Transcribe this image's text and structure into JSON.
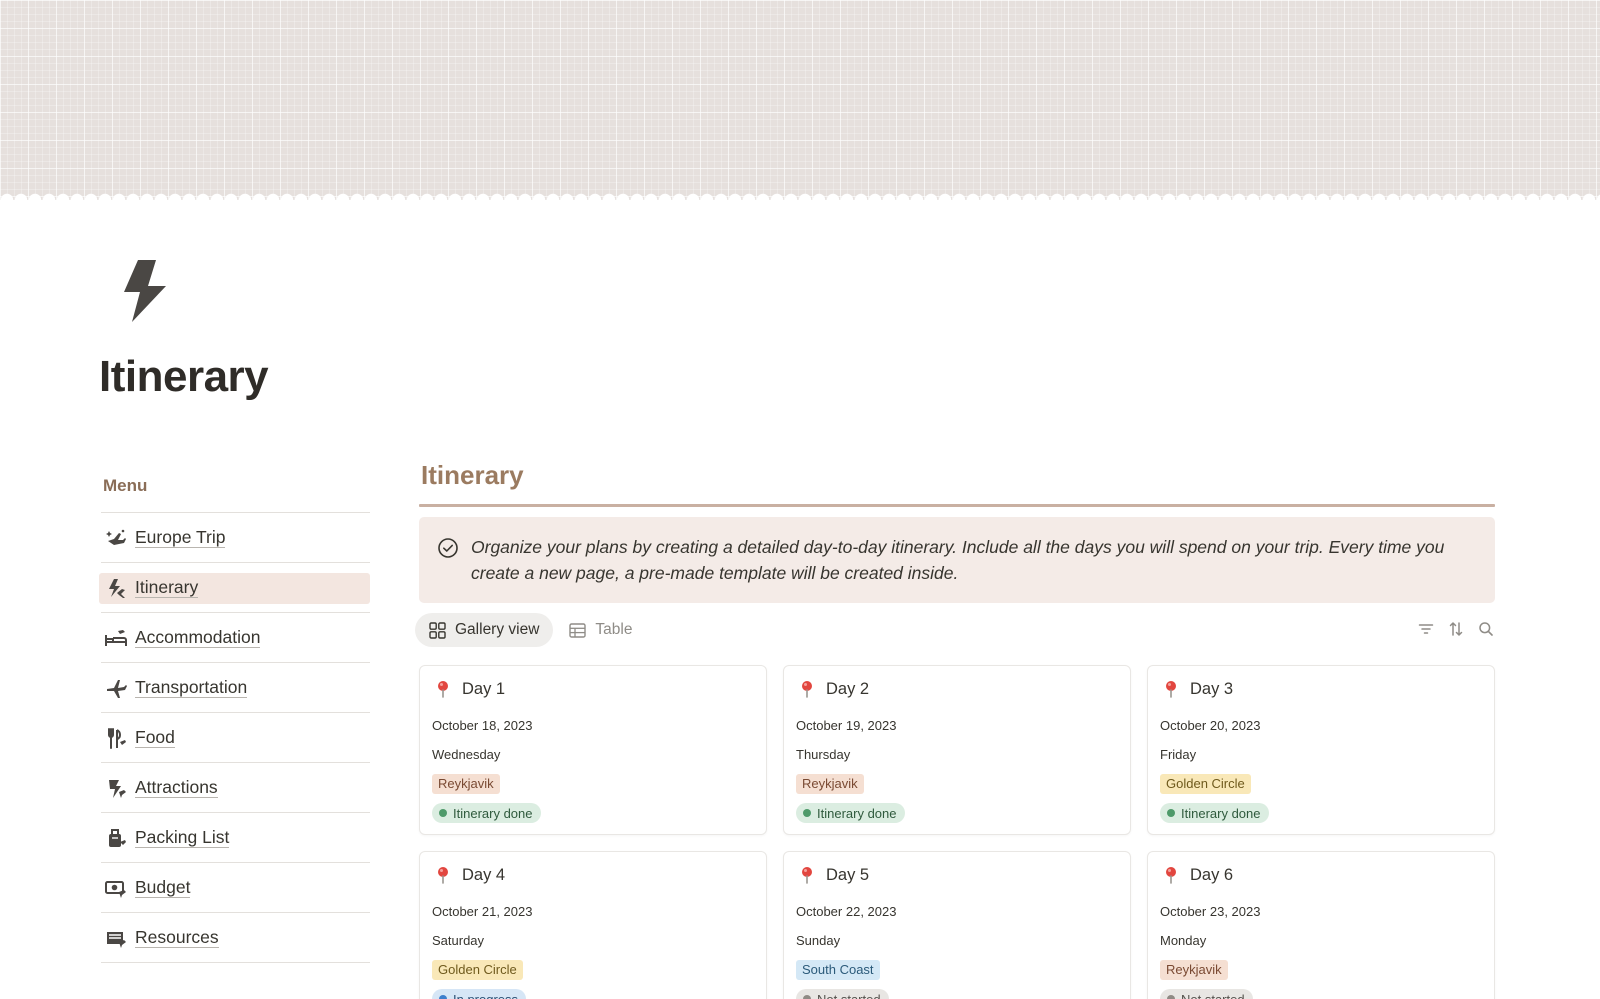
{
  "page": {
    "title": "Itinerary",
    "icon": "lightning-bolt-icon"
  },
  "menu": {
    "heading": "Menu",
    "items": [
      {
        "label": "Europe Trip",
        "icon": "airplane-sparkle-icon",
        "active": false
      },
      {
        "label": "Itinerary",
        "icon": "lightning-plane-icon",
        "active": true
      },
      {
        "label": "Accommodation",
        "icon": "bed-plane-icon",
        "active": false
      },
      {
        "label": "Transportation",
        "icon": "plane-icon",
        "active": false
      },
      {
        "label": "Food",
        "icon": "fork-knife-icon",
        "active": false
      },
      {
        "label": "Attractions",
        "icon": "attraction-icon",
        "active": false
      },
      {
        "label": "Packing List",
        "icon": "luggage-icon",
        "active": false
      },
      {
        "label": "Budget",
        "icon": "money-icon",
        "active": false
      },
      {
        "label": "Resources",
        "icon": "inbox-icon",
        "active": false
      }
    ]
  },
  "main": {
    "section_title": "Itinerary",
    "callout": {
      "icon": "check-circle-icon",
      "text": "Organize your plans by creating a detailed day-to-day itinerary. Include all the days you will spend on your trip. Every time you create a new page, a pre-made template will be created inside."
    },
    "views": [
      {
        "label": "Gallery view",
        "icon": "gallery-icon",
        "active": true
      },
      {
        "label": "Table",
        "icon": "table-icon",
        "active": false
      }
    ],
    "tools": [
      "filter-icon",
      "sort-icon",
      "search-icon"
    ],
    "cards": [
      {
        "title": "Day 1",
        "date": "October 18, 2023",
        "weekday": "Wednesday",
        "location": "Reykjavik",
        "status": "Itinerary done"
      },
      {
        "title": "Day 2",
        "date": "October 19, 2023",
        "weekday": "Thursday",
        "location": "Reykjavik",
        "status": "Itinerary done"
      },
      {
        "title": "Day 3",
        "date": "October 20, 2023",
        "weekday": "Friday",
        "location": "Golden Circle",
        "status": "Itinerary done"
      },
      {
        "title": "Day 4",
        "date": "October 21, 2023",
        "weekday": "Saturday",
        "location": "Golden Circle",
        "status": "In progress"
      },
      {
        "title": "Day 5",
        "date": "October 22, 2023",
        "weekday": "Sunday",
        "location": "South Coast",
        "status": "Not started"
      },
      {
        "title": "Day 6",
        "date": "October 23, 2023",
        "weekday": "Monday",
        "location": "Reykjavik",
        "status": "Not started"
      }
    ]
  },
  "colors": {
    "tag_reykjavik": {
      "bg": "#f5dfd2",
      "fg": "#7a4a33"
    },
    "tag_golden_circle": {
      "bg": "#f9e8b8",
      "fg": "#6f5a1d"
    },
    "tag_south_coast": {
      "bg": "#d4e8f6",
      "fg": "#2b5a7a"
    },
    "status_done": {
      "bg": "#dbede1",
      "fg": "#2f5a3d",
      "dot": "#4e9a6a"
    },
    "status_progress": {
      "bg": "#d6e6f6",
      "fg": "#2b4f74",
      "dot": "#3d7fcc"
    },
    "status_not_started": {
      "bg": "#e8e6e3",
      "fg": "#55524d",
      "dot": "#8f8b85"
    }
  }
}
